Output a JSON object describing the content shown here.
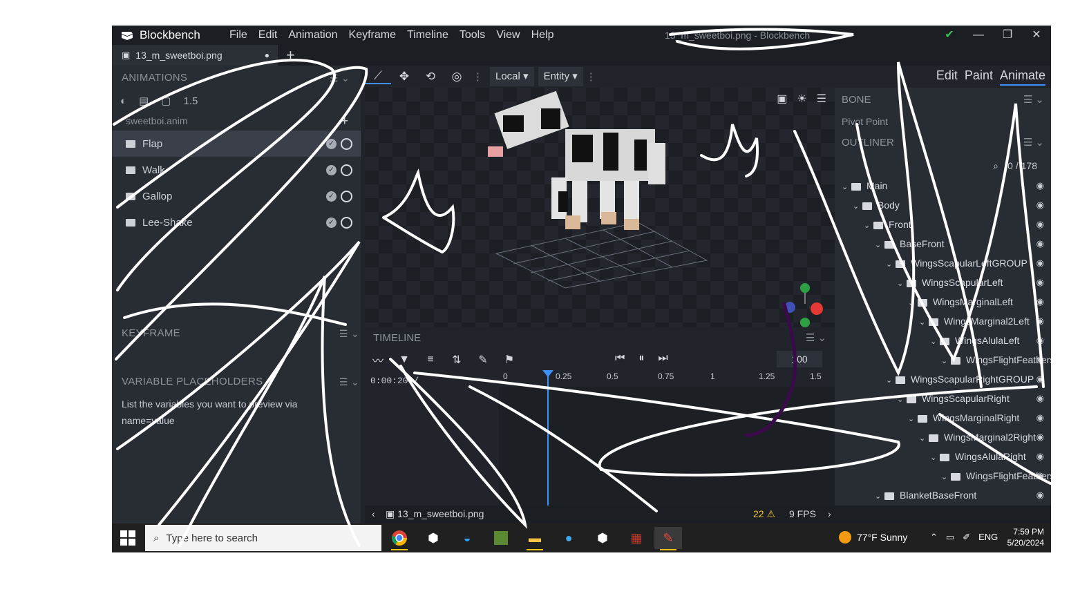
{
  "app": {
    "name": "Blockbench",
    "window_title": "13_m_sweetboi.png - Blockbench",
    "menu": [
      "File",
      "Edit",
      "Animation",
      "Keyframe",
      "Timeline",
      "Tools",
      "View",
      "Help"
    ],
    "window_controls": [
      "✔",
      "—",
      "❐",
      "✕"
    ]
  },
  "tab": {
    "label": "13_m_sweetboi.png",
    "dot": "●",
    "plus": "+"
  },
  "left_panel": {
    "animations_title": "ANIMATIONS",
    "animation_tools": [
      "◐",
      "▤",
      "▢",
      "1.5"
    ],
    "group_label": "sweetboi.anim",
    "items": [
      {
        "label": "Flap",
        "selected": true
      },
      {
        "label": "Walk",
        "selected": false
      },
      {
        "label": "Gallop",
        "selected": false
      },
      {
        "label": "Lee-Shake",
        "selected": false
      }
    ],
    "keyframe_title": "KEYFRAME",
    "variables_title": "VARIABLE PLACEHOLDERS",
    "variables_text": "List the variables you want to preview via name=value"
  },
  "toolbar": {
    "space_local": "Local",
    "space_entity": "Entity",
    "modes": [
      "Edit",
      "Paint",
      "Animate"
    ],
    "active_mode": "Animate"
  },
  "timeline": {
    "title": "TIMELINE",
    "time": "0:00:20 /",
    "fps_value": "100",
    "ruler": [
      "0",
      "0.25",
      "0.5",
      "0.75",
      "1",
      "1.25",
      "1.5"
    ]
  },
  "right_panel": {
    "bone_title": "BONE",
    "pivot_label": "Pivot Point",
    "outliner_title": "OUTLINER",
    "count": "0 / 178",
    "rows": [
      {
        "label": "Main",
        "depth": 0
      },
      {
        "label": "Body",
        "depth": 1
      },
      {
        "label": "Front",
        "depth": 2
      },
      {
        "label": "BaseFront",
        "depth": 3
      },
      {
        "label": "WingsScapularLeftGROUP",
        "depth": 4
      },
      {
        "label": "WingsScapularLeft",
        "depth": 5
      },
      {
        "label": "WingsMarginalLeft",
        "depth": 6
      },
      {
        "label": "WingsMarginal2Left",
        "depth": 7
      },
      {
        "label": "WingsAlulaLeft",
        "depth": 8
      },
      {
        "label": "WingsFlightFeathersLeft",
        "depth": 9
      },
      {
        "label": "WingsScapularRightGROUP",
        "depth": 4
      },
      {
        "label": "WingsScapularRight",
        "depth": 5
      },
      {
        "label": "WingsMarginalRight",
        "depth": 6
      },
      {
        "label": "WingsMarginal2Right",
        "depth": 7
      },
      {
        "label": "WingsAlulaRight",
        "depth": 8
      },
      {
        "label": "WingsFlightFeathersRight",
        "depth": 9
      },
      {
        "label": "BlanketBaseFront",
        "depth": 3
      }
    ]
  },
  "statusbar": {
    "file": "13_m_sweetboi.png",
    "warnings": "22 ⚠",
    "fps": "9 FPS"
  },
  "taskbar": {
    "search_placeholder": "Type here to search",
    "weather": "77°F  Sunny",
    "lang": "ENG",
    "time": "7:59 PM",
    "date": "5/20/2024"
  }
}
